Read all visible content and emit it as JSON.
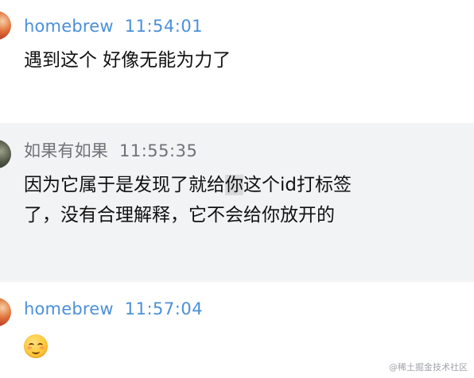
{
  "messages": [
    {
      "sender": "homebrew",
      "time": "11:54:01",
      "text": "遇到这个 好像无能为力了"
    },
    {
      "sender": "如果有如果",
      "time": "11:55:35",
      "text_before": "因为它属于是发现了就给",
      "text_highlight": "你",
      "text_after": "这个id打标签\n了，没有合理解释，它不会给你放开的"
    },
    {
      "sender": "homebrew",
      "time": "11:57:04",
      "emoji": "relieved-face"
    }
  ],
  "watermark": "@稀土掘金技术社区",
  "colors": {
    "homebrew_name": "#4a90d9",
    "other_name": "#6f7378",
    "highlight_bg": "#f2f3f5"
  }
}
